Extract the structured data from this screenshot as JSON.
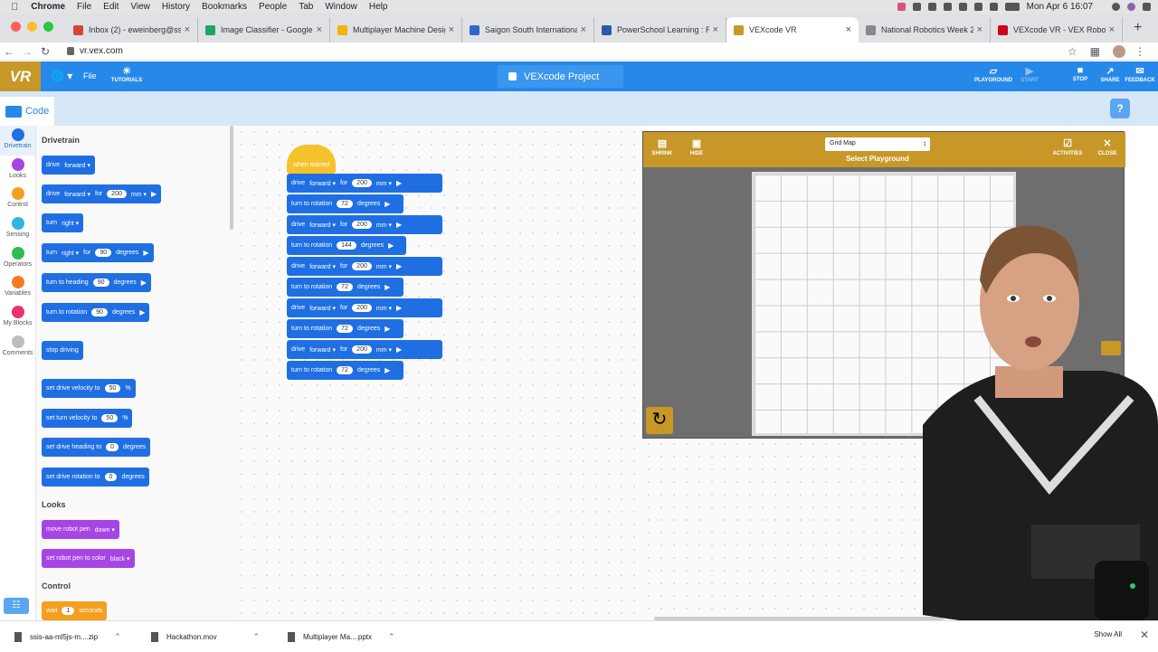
{
  "menubar": {
    "apple": "",
    "items": [
      "Chrome",
      "File",
      "Edit",
      "View",
      "History",
      "Bookmarks",
      "People",
      "Tab",
      "Window",
      "Help"
    ],
    "clock": "Mon Apr 6  16:07"
  },
  "tabs": [
    {
      "title": "Inbox (2) - eweinberg@ssis.e",
      "favicon_color": "#d44638"
    },
    {
      "title": "Image Classifier - Google Dr",
      "favicon_color": "#1fa463"
    },
    {
      "title": "Multiplayer Machine Design",
      "favicon_color": "#f4b400"
    },
    {
      "title": "Saigon South International S",
      "favicon_color": "#3366cc"
    },
    {
      "title": "PowerSchool Learning : Rob",
      "favicon_color": "#2a5aa8"
    },
    {
      "title": "VEXcode VR",
      "favicon_color": "#c79727"
    },
    {
      "title": "National Robotics Week 202",
      "favicon_color": "#888888"
    },
    {
      "title": "VEXcode VR - VEX Robotics",
      "favicon_color": "#d0021b"
    }
  ],
  "active_tab": 5,
  "address": {
    "url": "vr.vex.com"
  },
  "app": {
    "logo": "VR",
    "file_label": "File",
    "tutorials_label": "TUTORIALS",
    "project_name": "VEXcode Project",
    "playground_label": "PLAYGROUND",
    "start_label": "START",
    "stop_label": "STOP",
    "share_label": "SHARE",
    "feedback_label": "FEEDBACK",
    "code_tab_label": "Code",
    "help_label": "?"
  },
  "categories": [
    {
      "label": "Drivetrain",
      "color": "#1f6fe3"
    },
    {
      "label": "Looks",
      "color": "#a645e5"
    },
    {
      "label": "Control",
      "color": "#f39f1f"
    },
    {
      "label": "Sensing",
      "color": "#35b3e0"
    },
    {
      "label": "Operators",
      "color": "#2dbd4f"
    },
    {
      "label": "Variables",
      "color": "#f47b22"
    },
    {
      "label": "My Blocks",
      "color": "#e8346a"
    },
    {
      "label": "Comments",
      "color": "#bdbdbd"
    }
  ],
  "palette": {
    "drivetrain_title": "Drivetrain",
    "looks_title": "Looks",
    "control_title": "Control",
    "blocks": {
      "drive": [
        "drive",
        "forward"
      ],
      "drive_for": [
        "drive",
        "forward",
        "for",
        "200",
        "mm"
      ],
      "turn": [
        "turn",
        "right"
      ],
      "turn_for": [
        "turn",
        "right",
        "for",
        "90",
        "degrees"
      ],
      "turn_heading": [
        "turn to heading",
        "90",
        "degrees"
      ],
      "turn_rotation": [
        "turn to rotation",
        "90",
        "degrees"
      ],
      "stop": [
        "stop driving"
      ],
      "drive_vel": [
        "set drive velocity to",
        "50",
        "%"
      ],
      "turn_vel": [
        "set turn velocity to",
        "50",
        "%"
      ],
      "drive_heading": [
        "set drive heading to",
        "0",
        "degrees"
      ],
      "drive_rot": [
        "set drive rotation to",
        "0",
        "degrees"
      ],
      "pen": [
        "move robot pen",
        "down"
      ],
      "pen_color": [
        "set robot pen to color",
        "black"
      ],
      "wait": [
        "wait",
        "1",
        "seconds"
      ]
    }
  },
  "script": {
    "hat": "when started",
    "drive": [
      "drive",
      "forward",
      "for",
      "200",
      "mm"
    ],
    "turn72": [
      "turn to rotation",
      "72",
      "degrees"
    ],
    "turn144": [
      "turn to rotation",
      "144",
      "degrees"
    ]
  },
  "playground": {
    "shrink_label": "SHRINK",
    "hide_label": "HIDE",
    "select_value": "Grid Map",
    "select_label": "Select Playground",
    "activities_label": "ACTIVITIES",
    "close_label": "CLOSE"
  },
  "downloads": [
    {
      "name": "ssis-aa-ml5js-m....zip"
    },
    {
      "name": "Hackathon.mov"
    },
    {
      "name": "Multiplayer Ma....pptx"
    }
  ],
  "downloads_show_all": "Show All"
}
